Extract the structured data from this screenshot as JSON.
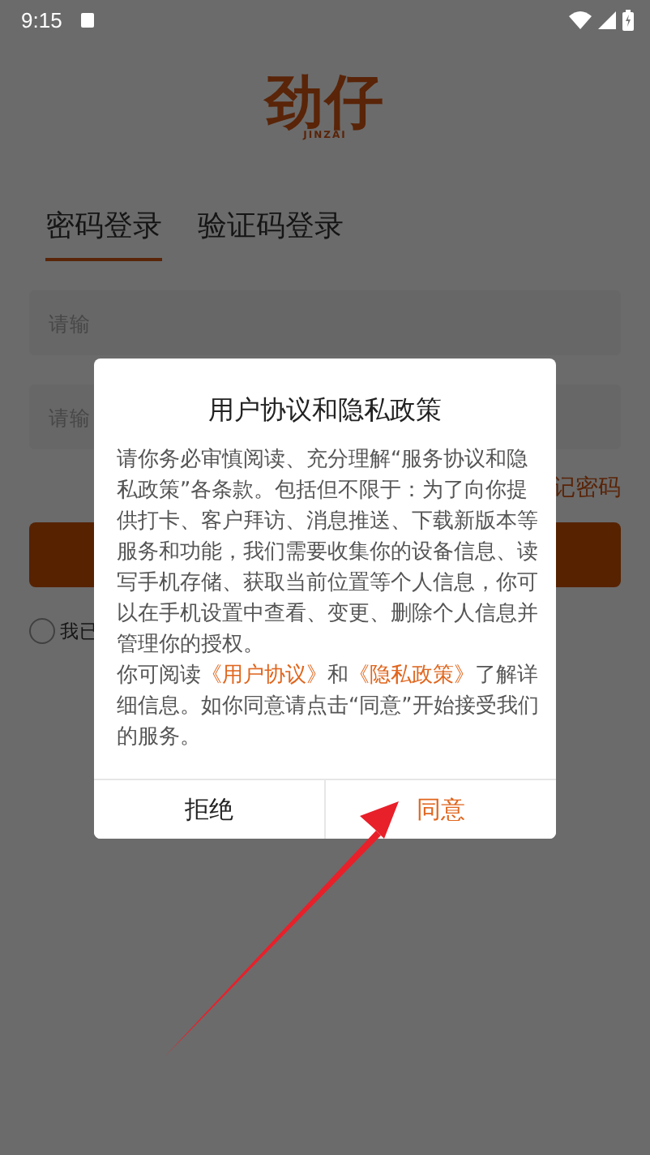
{
  "status_bar": {
    "time": "9:15"
  },
  "logo": {
    "name": "劲仔",
    "subtitle": "JINZAI"
  },
  "tabs": [
    {
      "label": "密码登录",
      "selected": true
    },
    {
      "label": "验证码登录",
      "selected": false
    }
  ],
  "fields": [
    {
      "placeholder": "请输"
    },
    {
      "placeholder": "请输"
    }
  ],
  "forgot_password": "记密码",
  "agreement_checkbox": {
    "label": "我已",
    "checked": false
  },
  "dialog": {
    "title": "用户协议和隐私政策",
    "paragraphs": [
      [
        {
          "kind": "text",
          "text": "请你务必审慎阅读、充分理解“服务协议和隐私政策”各条款。包括但不限于：为了向你提供打卡、客户拜访、消息推送、下载新版本等服务和功能，我们需要收集你的设备信息、读写手机存储、获取当前位置等个人信息，你可以在手机设置中查看、变更、删除个人信息并管理你的授权。"
        }
      ],
      [
        {
          "kind": "text",
          "text": "你可阅读"
        },
        {
          "kind": "link",
          "text": "《用户协议》"
        },
        {
          "kind": "text",
          "text": "和"
        },
        {
          "kind": "link",
          "text": "《隐私政策》"
        },
        {
          "kind": "text",
          "text": "了解详细信息。如你同意请点击“同意”开始接受我们的服务。"
        }
      ]
    ],
    "buttons": [
      {
        "label": "拒绝",
        "kind": "secondary"
      },
      {
        "label": "同意",
        "kind": "primary"
      }
    ]
  }
}
